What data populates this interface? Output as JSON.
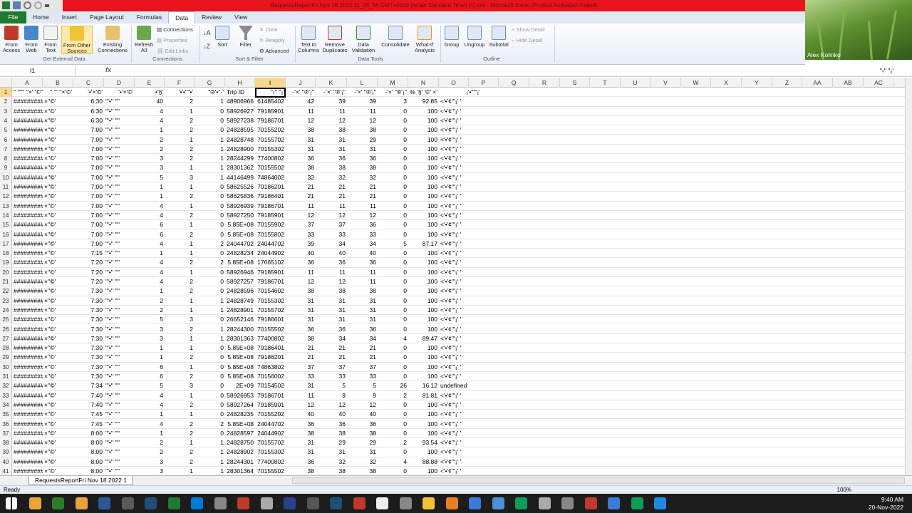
{
  "window": {
    "title": "RequestsReportFri Nov 18 2022 11_25_58 GMT+0200 (Israel Standard Time) (1).csv - Microsoft Excel (Product Activation Failed)"
  },
  "tabs": [
    "File",
    "Home",
    "Insert",
    "Page Layout",
    "Formulas",
    "Data",
    "Review",
    "View"
  ],
  "ribbon": {
    "from_access": "From Access",
    "from_web": "From Web",
    "from_text": "From Text",
    "from_other": "From Other Sources",
    "existing": "Existing Connections",
    "get_external": "Get External Data",
    "refresh": "Refresh All",
    "connections": "Connections",
    "properties": "Properties",
    "edit_links": "Edit Links",
    "connections_group": "Connections",
    "sort": "Sort",
    "filter": "Filter",
    "clear": "Clear",
    "reapply": "Reapply",
    "advanced": "Advanced",
    "sort_filter_group": "Sort & Filter",
    "text_to_columns": "Text to Columns",
    "remove_duplicates": "Remove Duplicates",
    "data_validation": "Data Validation",
    "consolidate": "Consolidate",
    "what_if": "What-If Analysis",
    "data_tools_group": "Data Tools",
    "group": "Group",
    "ungroup": "Ungroup",
    "subtotal": "Subtotal",
    "show_detail": "Show Detail",
    "hide_detail": "Hide Detail",
    "outline_group": "Outline"
  },
  "video": {
    "name": "Alex Kolinko"
  },
  "formula_bar": {
    "cell_ref": "I1",
    "fx": "fx",
    "value": "\"‹'' ''¡'"
  },
  "columns": [
    "A",
    "B",
    "C",
    "D",
    "E",
    "F",
    "G",
    "H",
    "I",
    "J",
    "K",
    "L",
    "M",
    "N",
    "O",
    "P",
    "Q",
    "R",
    "S",
    "T",
    "U",
    "V",
    "W",
    "X",
    "Y",
    "Z",
    "AA",
    "AB",
    "AC"
  ],
  "header_row": [
    "'' '''''' ''×' '©'' '' ''",
    "'' '''",
    "''×'©'",
    "'•'×'©'",
    "•'§'",
    "'•'•'''''•'",
    "''®'•''-'",
    "Trip ID",
    "\"‹'' ''¡'",
    "'×' ''®'¡''",
    "-'×'",
    "''®'¡''",
    "-'×'",
    "''®'¡''",
    "-'×'",
    "''®'¡''",
    "% '§' '©' ×'",
    "¡'•'''''¡'"
  ],
  "header_cells": {
    "A": "'' '''''' ''×' '©'' '' ''",
    "B": "'' ''' ''×'©'",
    "C": "'•'×'©'",
    "D": "'•'×'©'",
    "E": "•'§'",
    "F": "'•'•''''•'",
    "G": "''®'•''-'",
    "H": "Trip ID",
    "I": "\"‹'' ''¡'",
    "J": "-'×' ''®'¡''",
    "K": "-'×' ''®'¡''",
    "L": "-'×' ''®'¡''",
    "M": "-'×' ''®'¡''",
    "N": "% '§' '©' ×'",
    "O": "¡'•'''''¡'"
  },
  "rows": [
    [
      "#########",
      "×''©'",
      "6:30",
      "'''•'' ''''",
      "40",
      "2",
      "1",
      "48906966",
      "61485402",
      "42",
      "39",
      "39",
      "3",
      "92.85",
      "<'•'¢'''¡' '"
    ],
    [
      "#########",
      "×''©'",
      "6:30",
      "'''•'' ''''",
      "4",
      "1",
      "0",
      "58926927",
      "79185901",
      "11",
      "11",
      "11",
      "0",
      "100",
      "<'•'¢'''¡' '"
    ],
    [
      "#########",
      "×''©'",
      "6:30",
      "'''•'' ''''",
      "4",
      "2",
      "0",
      "58927238",
      "79186701",
      "12",
      "12",
      "12",
      "0",
      "100",
      "<'•'¢'''¡' '"
    ],
    [
      "#########",
      "×''©'",
      "7:00",
      "'''•'' ''''",
      "1",
      "2",
      "0",
      "24828595",
      "70155202",
      "38",
      "38",
      "38",
      "0",
      "100",
      "<'•'¢'''¡' '"
    ],
    [
      "#########",
      "×''©'",
      "7:00",
      "'''•'' ''''",
      "2",
      "1",
      "1",
      "24828748",
      "70155702",
      "31",
      "31",
      "29",
      "0",
      "100",
      "<'•'¢'''¡' '"
    ],
    [
      "#########",
      "×''©'",
      "7:00",
      "'''•'' ''''",
      "2",
      "2",
      "1",
      "24828900",
      "70155302",
      "31",
      "31",
      "31",
      "0",
      "100",
      "<'•'¢'''¡' '"
    ],
    [
      "#########",
      "×''©'",
      "7:00",
      "'''•'' ''''",
      "3",
      "2",
      "1",
      "28244299",
      "77400802",
      "36",
      "36",
      "36",
      "0",
      "100",
      "<'•'¢'''¡' '"
    ],
    [
      "#########",
      "×''©'",
      "7:00",
      "'''•'' ''''",
      "3",
      "1",
      "1",
      "28301362",
      "70155502",
      "38",
      "38",
      "38",
      "0",
      "100",
      "<'•'¢'''¡' '"
    ],
    [
      "#########",
      "×''©'",
      "7:00",
      "'''•'' ''''",
      "5",
      "3",
      "1",
      "44146499",
      "74864002",
      "32",
      "32",
      "32",
      "0",
      "100",
      "<'•'¢'''¡' '"
    ],
    [
      "#########",
      "×''©'",
      "7:00",
      "'''•'' ''''",
      "1",
      "1",
      "0",
      "58625526",
      "79186201",
      "21",
      "21",
      "21",
      "0",
      "100",
      "<'•'¢'''¡' '"
    ],
    [
      "#########",
      "×''©'",
      "7:00",
      "'''•'' ''''",
      "1",
      "2",
      "0",
      "58625836",
      "79186401",
      "21",
      "21",
      "21",
      "0",
      "100",
      "<'•'¢'''¡' '"
    ],
    [
      "#########",
      "×''©'",
      "7:00",
      "'''•'' ''''",
      "4",
      "1",
      "0",
      "58926939",
      "79186701",
      "11",
      "11",
      "11",
      "0",
      "100",
      "<'•'¢'''¡' '"
    ],
    [
      "#########",
      "×''©'",
      "7:00",
      "'''•'' ''''",
      "4",
      "2",
      "0",
      "58927250",
      "79185901",
      "12",
      "12",
      "12",
      "0",
      "100",
      "<'•'¢'''¡' '"
    ],
    [
      "#########",
      "×''©'",
      "7:00",
      "'''•'' ''''",
      "6",
      "1",
      "0",
      "5.85E+08",
      "70155902",
      "37",
      "37",
      "36",
      "0",
      "100",
      "<'•'¢'''¡' '"
    ],
    [
      "#########",
      "×''©'",
      "7:00",
      "'''•'' ''''",
      "6",
      "2",
      "0",
      "5.85E+08",
      "70155802",
      "33",
      "33",
      "33",
      "0",
      "100",
      "<'•'¢'''¡' '"
    ],
    [
      "#########",
      "×''©'",
      "7:00",
      "'''•'' ''''",
      "4",
      "1",
      "2",
      "24044702",
      "24044702",
      "39",
      "34",
      "34",
      "5",
      "87.17",
      "<'•'¢'''¡' '"
    ],
    [
      "#########",
      "×''©'",
      "7:15",
      "'''•'' ''''",
      "1",
      "1",
      "0",
      "24828234",
      "24044902",
      "40",
      "40",
      "40",
      "0",
      "100",
      "<'•'¢'''¡' '"
    ],
    [
      "#########",
      "×''©'",
      "7:20",
      "'''•'' ''''",
      "4",
      "2",
      "2",
      "5.85E+08",
      "17665102",
      "36",
      "36",
      "36",
      "0",
      "100",
      "<'•'¢'''¡' '"
    ],
    [
      "#########",
      "×''©'",
      "7:20",
      "'''•'' ''''",
      "4",
      "1",
      "0",
      "58926946",
      "79185901",
      "11",
      "11",
      "11",
      "0",
      "100",
      "<'•'¢'''¡' '"
    ],
    [
      "#########",
      "×''©'",
      "7:20",
      "'''•'' ''''",
      "4",
      "2",
      "0",
      "58927257",
      "79186701",
      "12",
      "12",
      "11",
      "0",
      "100",
      "<'•'¢'''¡' '"
    ],
    [
      "#########",
      "×''©'",
      "7:30",
      "'''•'' ''''",
      "1",
      "2",
      "0",
      "24828596",
      "70154602",
      "38",
      "38",
      "38",
      "0",
      "100",
      "<'•'¢'''¡' '"
    ],
    [
      "#########",
      "×''©'",
      "7:30",
      "'''•'' ''''",
      "2",
      "1",
      "1",
      "24828749",
      "70155302",
      "31",
      "31",
      "31",
      "0",
      "100",
      "<'•'¢'''¡' '"
    ],
    [
      "#########",
      "×''©'",
      "7:30",
      "'''•'' ''''",
      "2",
      "1",
      "1",
      "24828901",
      "70155702",
      "31",
      "31",
      "31",
      "0",
      "100",
      "<'•'¢'''¡' '"
    ],
    [
      "#########",
      "×''©'",
      "7:30",
      "'''•'' ''''",
      "5",
      "3",
      "0",
      "26652146",
      "79186601",
      "31",
      "31",
      "31",
      "0",
      "100",
      "<'•'¢'''¡' '"
    ],
    [
      "#########",
      "×''©'",
      "7:30",
      "'''•'' ''''",
      "3",
      "2",
      "1",
      "28244300",
      "70155502",
      "36",
      "36",
      "36",
      "0",
      "100",
      "<'•'¢'''¡' '"
    ],
    [
      "#########",
      "×''©'",
      "7:30",
      "'''•'' ''''",
      "3",
      "1",
      "1",
      "28301363",
      "77400802",
      "38",
      "34",
      "34",
      "4",
      "89.47",
      "<'•'¢'''¡' '"
    ],
    [
      "#########",
      "×''©'",
      "7:30",
      "'''•'' ''''",
      "1",
      "1",
      "0",
      "5.85E+08",
      "79186401",
      "21",
      "21",
      "21",
      "0",
      "100",
      "<'•'¢'''¡' '"
    ],
    [
      "#########",
      "×''©'",
      "7:30",
      "'''•'' ''''",
      "1",
      "2",
      "0",
      "5.85E+08",
      "79186201",
      "21",
      "21",
      "21",
      "0",
      "100",
      "<'•'¢'''¡' '"
    ],
    [
      "#########",
      "×''©'",
      "7:30",
      "'''•'' ''''",
      "6",
      "1",
      "0",
      "5.85E+08",
      "74863802",
      "37",
      "37",
      "37",
      "0",
      "100",
      "<'•'¢'''¡' '"
    ],
    [
      "#########",
      "×''©'",
      "7:30",
      "'''•'' ''''",
      "6",
      "2",
      "0",
      "5.85E+08",
      "70156002",
      "33",
      "33",
      "33",
      "0",
      "100",
      "<'•'¢'''¡' '"
    ],
    [
      "#########",
      "×''©'",
      "7:34",
      "'''•'' ''''",
      "5",
      "3",
      "0",
      "2E+09",
      "70154502",
      "31",
      "5",
      "5",
      "26",
      "16.12",
      "undefined"
    ],
    [
      "#########",
      "×''©'",
      "7:40",
      "'''•'' ''''",
      "4",
      "1",
      "0",
      "58926953",
      "79186701",
      "11",
      "9",
      "9",
      "2",
      "81.81",
      "<'•'¢'''¡' '"
    ],
    [
      "#########",
      "×''©'",
      "7:40",
      "'''•'' ''''",
      "4",
      "2",
      "0",
      "58927264",
      "79185901",
      "12",
      "12",
      "12",
      "0",
      "100",
      "<'•'¢'''¡' '"
    ],
    [
      "#########",
      "×''©'",
      "7:45",
      "'''•'' ''''",
      "1",
      "1",
      "0",
      "24828235",
      "70155202",
      "40",
      "40",
      "40",
      "0",
      "100",
      "<'•'¢'''¡' '"
    ],
    [
      "#########",
      "×''©'",
      "7:45",
      "'''•'' ''''",
      "4",
      "2",
      "2",
      "5.85E+08",
      "24044702",
      "36",
      "36",
      "36",
      "0",
      "100",
      "<'•'¢'''¡' '"
    ],
    [
      "#########",
      "×''©'",
      "8:00",
      "'''•'' ''''",
      "1",
      "2",
      "0",
      "24828597",
      "24044902",
      "38",
      "38",
      "38",
      "0",
      "100",
      "<'•'¢'''¡' '"
    ],
    [
      "#########",
      "×''©'",
      "8:00",
      "'''•'' ''''",
      "2",
      "1",
      "1",
      "24828750",
      "70155702",
      "31",
      "29",
      "29",
      "2",
      "93.54",
      "<'•'¢'''¡' '"
    ],
    [
      "#########",
      "×''©'",
      "8:00",
      "'''•'' ''''",
      "2",
      "2",
      "1",
      "24828902",
      "70155302",
      "31",
      "31",
      "31",
      "0",
      "100",
      "<'•'¢'''¡' '"
    ],
    [
      "#########",
      "×''©'",
      "8:00",
      "'''•'' ''''",
      "3",
      "2",
      "1",
      "28244301",
      "77400802",
      "36",
      "32",
      "32",
      "4",
      "88.88",
      "<'•'¢'''¡' '"
    ],
    [
      "#########",
      "×''©'",
      "8:00",
      "'''•'' ''''",
      "3",
      "1",
      "1",
      "28301364",
      "70155502",
      "38",
      "38",
      "38",
      "0",
      "100",
      "<'•'¢'''¡' '"
    ]
  ],
  "sheet": {
    "tab_name": "RequestsReportFri Nov 18 2022 1"
  },
  "status": {
    "text": "Ready",
    "zoom": "100%"
  },
  "clock": {
    "time": "9:40 AM",
    "date": "20-Nov-2022"
  }
}
